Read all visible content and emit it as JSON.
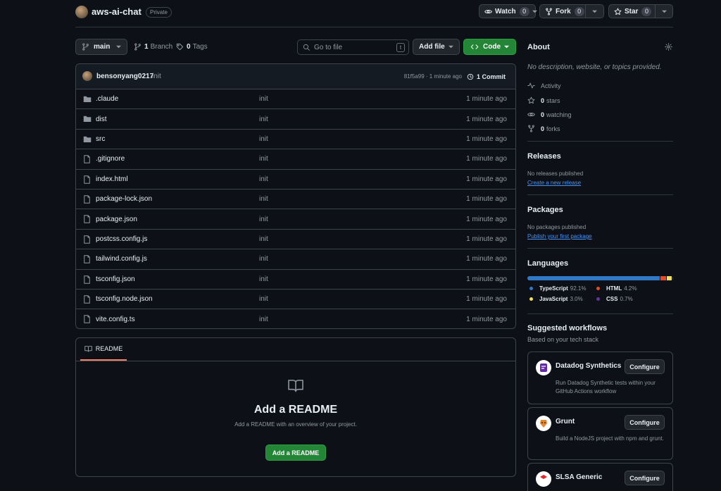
{
  "repo": {
    "name": "aws-ai-chat",
    "visibility": "Private"
  },
  "header_actions": {
    "watch": {
      "label": "Watch",
      "count": "0"
    },
    "fork": {
      "label": "Fork",
      "count": "0"
    },
    "star": {
      "label": "Star",
      "count": "0"
    }
  },
  "toolbar": {
    "branch": "main",
    "branches_count": "1",
    "branches_label": "Branch",
    "tags_count": "0",
    "tags_label": "Tags",
    "search_placeholder": "Go to file",
    "search_shortcut": "t",
    "add_file_label": "Add file",
    "code_label": "Code"
  },
  "latest_commit": {
    "author": "bensonyang0217",
    "message": "init",
    "hash_time": "81f5a99 · 1 minute ago",
    "commits_label": "1 Commit"
  },
  "files": [
    {
      "name": ".claude",
      "type": "folder",
      "message": "init",
      "time": "1 minute ago"
    },
    {
      "name": "dist",
      "type": "folder",
      "message": "init",
      "time": "1 minute ago"
    },
    {
      "name": "src",
      "type": "folder",
      "message": "init",
      "time": "1 minute ago"
    },
    {
      "name": ".gitignore",
      "type": "file",
      "message": "init",
      "time": "1 minute ago"
    },
    {
      "name": "index.html",
      "type": "file",
      "message": "init",
      "time": "1 minute ago"
    },
    {
      "name": "package-lock.json",
      "type": "file",
      "message": "init",
      "time": "1 minute ago"
    },
    {
      "name": "package.json",
      "type": "file",
      "message": "init",
      "time": "1 minute ago"
    },
    {
      "name": "postcss.config.js",
      "type": "file",
      "message": "init",
      "time": "1 minute ago"
    },
    {
      "name": "tailwind.config.js",
      "type": "file",
      "message": "init",
      "time": "1 minute ago"
    },
    {
      "name": "tsconfig.json",
      "type": "file",
      "message": "init",
      "time": "1 minute ago"
    },
    {
      "name": "tsconfig.node.json",
      "type": "file",
      "message": "init",
      "time": "1 minute ago"
    },
    {
      "name": "vite.config.ts",
      "type": "file",
      "message": "init",
      "time": "1 minute ago"
    }
  ],
  "readme": {
    "tab": "README",
    "title": "Add a README",
    "description": "Add a README with an overview of your project.",
    "button": "Add a README"
  },
  "about": {
    "title": "About",
    "description": "No description, website, or topics provided.",
    "activity": "Activity",
    "stars_count": "0",
    "stars_label": "stars",
    "watching_count": "0",
    "watching_label": "watching",
    "forks_count": "0",
    "forks_label": "forks"
  },
  "releases": {
    "title": "Releases",
    "empty": "No releases published",
    "link": "Create a new release"
  },
  "packages": {
    "title": "Packages",
    "empty": "No packages published",
    "link": "Publish your first package"
  },
  "languages": {
    "title": "Languages",
    "items": [
      {
        "name": "TypeScript",
        "percent": "92.1%",
        "value": 92.1,
        "color": "#3178c6"
      },
      {
        "name": "HTML",
        "percent": "4.2%",
        "value": 4.2,
        "color": "#e34c26"
      },
      {
        "name": "JavaScript",
        "percent": "3.0%",
        "value": 3.0,
        "color": "#f1e05a"
      },
      {
        "name": "CSS",
        "percent": "0.7%",
        "value": 0.7,
        "color": "#663399"
      }
    ]
  },
  "workflows": {
    "title": "Suggested workflows",
    "subtitle": "Based on your tech stack",
    "items": [
      {
        "name": "Datadog Synthetics",
        "description": "Run Datadog Synthetic tests within your GitHub Actions workflow",
        "button": "Configure"
      },
      {
        "name": "Grunt",
        "description": "Build a NodeJS project with npm and grunt.",
        "button": "Configure"
      },
      {
        "name": "SLSA Generic",
        "button": "Configure"
      }
    ]
  },
  "colors": {
    "accent": "#238636",
    "link": "#4493f8",
    "background": "#0d1117",
    "border": "#3d444d"
  }
}
